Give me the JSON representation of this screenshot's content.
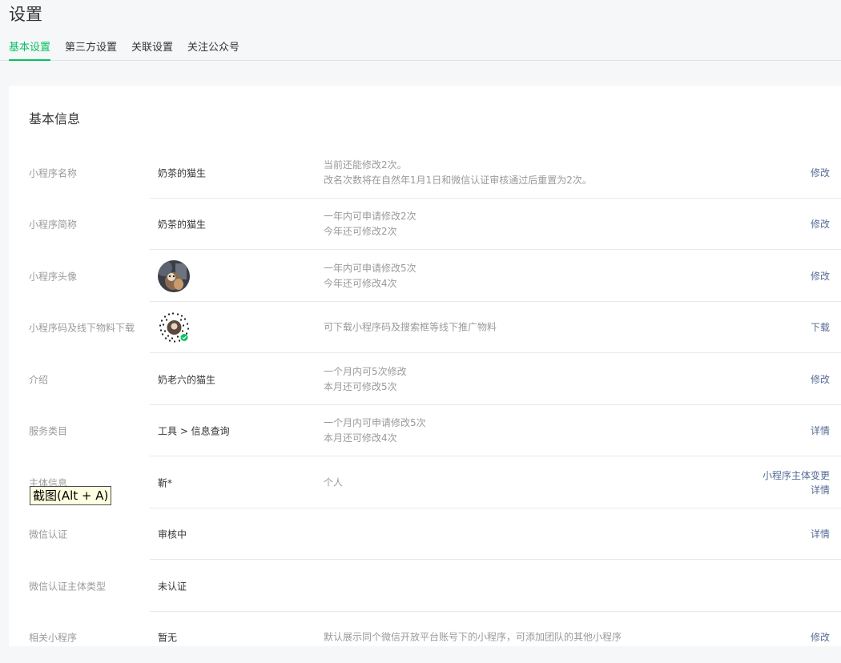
{
  "header": {
    "title": "设置",
    "tabs": [
      {
        "label": "基本设置",
        "active": true
      },
      {
        "label": "第三方设置",
        "active": false
      },
      {
        "label": "关联设置",
        "active": false
      },
      {
        "label": "关注公众号",
        "active": false
      }
    ]
  },
  "card": {
    "title": "基本信息",
    "rows": [
      {
        "label": "小程序名称",
        "value": "奶茶的猫生",
        "desc": [
          "当前还能修改2次。",
          "改名次数将在自然年1月1日和微信认证审核通过后重置为2次。"
        ],
        "actions": [
          "修改"
        ]
      },
      {
        "label": "小程序简称",
        "value": "奶茶的猫生",
        "desc": [
          "一年内可申请修改2次",
          "今年还可修改2次"
        ],
        "actions": [
          "修改"
        ]
      },
      {
        "label": "小程序头像",
        "value": "",
        "desc": [
          "一年内可申请修改5次",
          "今年还可修改4次"
        ],
        "actions": [
          "修改"
        ]
      },
      {
        "label": "小程序码及线下物料下载",
        "value": "",
        "desc": [
          "可下载小程序码及搜索框等线下推广物料"
        ],
        "actions": [
          "下载"
        ]
      },
      {
        "label": "介绍",
        "value": "奶老六的猫生",
        "desc": [
          "一个月内可5次修改",
          "本月还可修改5次"
        ],
        "actions": [
          "修改"
        ]
      },
      {
        "label": "服务类目",
        "value": "工具 > 信息查询",
        "desc": [
          "一个月内可申请修改5次",
          "本月还可修改4次"
        ],
        "actions": [
          "详情"
        ]
      },
      {
        "label": "主体信息",
        "value": "靳*",
        "desc": [
          "个人"
        ],
        "actions": [
          "小程序主体变更",
          "详情"
        ]
      },
      {
        "label": "微信认证",
        "value": "审核中",
        "desc": [],
        "actions": [
          "详情"
        ]
      },
      {
        "label": "微信认证主体类型",
        "value": "未认证",
        "desc": [],
        "actions": []
      },
      {
        "label": "相关小程序",
        "value": "暂无",
        "desc": [
          "默认展示同个微信开放平台账号下的小程序，可添加团队的其他小程序"
        ],
        "actions": [
          "修改"
        ]
      }
    ]
  },
  "tooltip": {
    "text": "截图(Alt + A)"
  },
  "colors": {
    "accent": "#07c160",
    "link": "#576b95",
    "muted": "#9a9a9a"
  }
}
